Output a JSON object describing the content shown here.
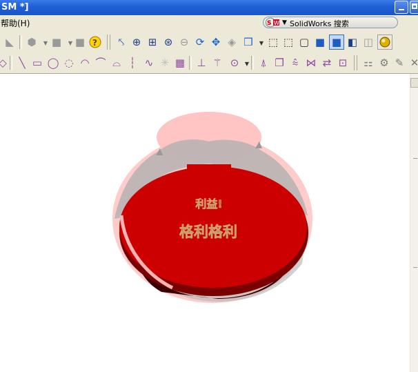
{
  "window": {
    "title": "SM *]"
  },
  "menubar": {
    "help_label": "帮助(H)"
  },
  "search": {
    "label": "SolidWorks 搜索"
  },
  "model": {
    "text_top": "利益!",
    "text_main": "格利格利",
    "colors": {
      "lid": "#cc0000",
      "bowl_ghost": "#ffb5b5",
      "shadow": "#8c8c8c"
    }
  }
}
